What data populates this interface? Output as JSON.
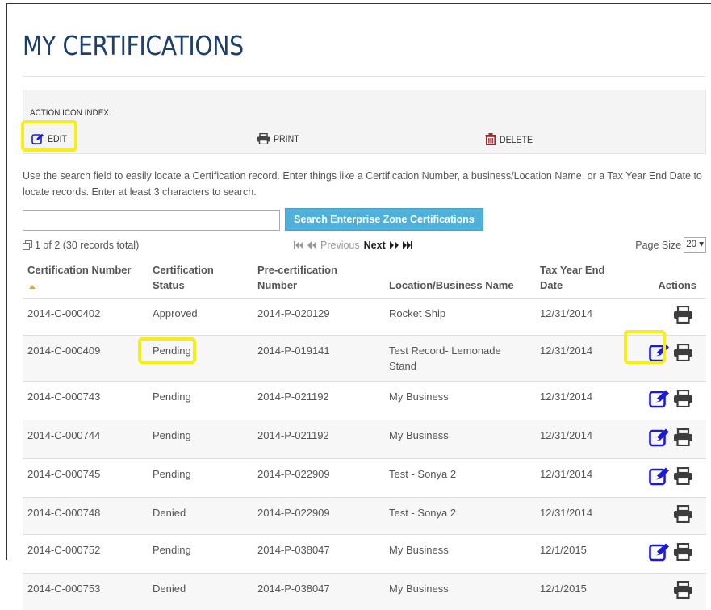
{
  "page": {
    "title": "MY CERTIFICATIONS"
  },
  "icon_index": {
    "heading": "ACTION ICON INDEX:",
    "edit": "EDIT",
    "print": "PRINT",
    "delete": "DELETE"
  },
  "help_text": "Use the search field to easily locate a Certification record. Enter things like a Certification Number, a business/Location Name, or a Tax Year End Date to locate records. Enter at least 3 characters to search.",
  "search": {
    "value": "",
    "placeholder": "",
    "button_label": "Search Enterprise Zone Certifications"
  },
  "pager": {
    "info": "1 of 2 (30 records total)",
    "previous": "Previous",
    "next": "Next",
    "page_size_label": "Page Size",
    "page_size_value": "20"
  },
  "table": {
    "headers": {
      "cert_number": "Certification Number",
      "status_line1": "Certification",
      "status_line2": "Status",
      "precert_line1": "Pre-certification",
      "precert_line2": "Number",
      "location": "Location/Business Name",
      "tax_line1": "Tax Year End",
      "tax_line2": "Date",
      "actions": "Actions"
    },
    "rows": [
      {
        "cert": "2014-C-000402",
        "status": "Approved",
        "precert": "2014-P-020129",
        "location": "Rocket Ship",
        "date": "12/31/2014",
        "edit": false
      },
      {
        "cert": "2014-C-000409",
        "status": "Pending",
        "precert": "2014-P-019141",
        "location": "Test Record- Lemonade Stand",
        "date": "12/31/2014",
        "edit": true
      },
      {
        "cert": "2014-C-000743",
        "status": "Pending",
        "precert": "2014-P-021192",
        "location": "My Business",
        "date": "12/31/2014",
        "edit": true
      },
      {
        "cert": "2014-C-000744",
        "status": "Pending",
        "precert": "2014-P-021192",
        "location": "My Business",
        "date": "12/31/2014",
        "edit": true
      },
      {
        "cert": "2014-C-000745",
        "status": "Pending",
        "precert": "2014-P-022909",
        "location": "Test - Sonya 2",
        "date": "12/31/2014",
        "edit": true
      },
      {
        "cert": "2014-C-000748",
        "status": "Denied",
        "precert": "2014-P-022909",
        "location": "Test - Sonya 2",
        "date": "12/31/2014",
        "edit": false
      },
      {
        "cert": "2014-C-000752",
        "status": "Pending",
        "precert": "2014-P-038047",
        "location": "My Business",
        "date": "12/1/2015",
        "edit": true
      },
      {
        "cert": "2014-C-000753",
        "status": "Denied",
        "precert": "2014-P-038047",
        "location": "My Business",
        "date": "12/1/2015",
        "edit": false
      }
    ]
  },
  "colors": {
    "title": "#1c3f6e",
    "edit_icon": "#1b1bd6",
    "delete_icon": "#b41e24",
    "search_button": "#4fb0da",
    "highlight": "#f4ee1c"
  },
  "icons": {
    "edit": "edit-icon",
    "print": "printer-icon",
    "delete": "trash-icon"
  }
}
